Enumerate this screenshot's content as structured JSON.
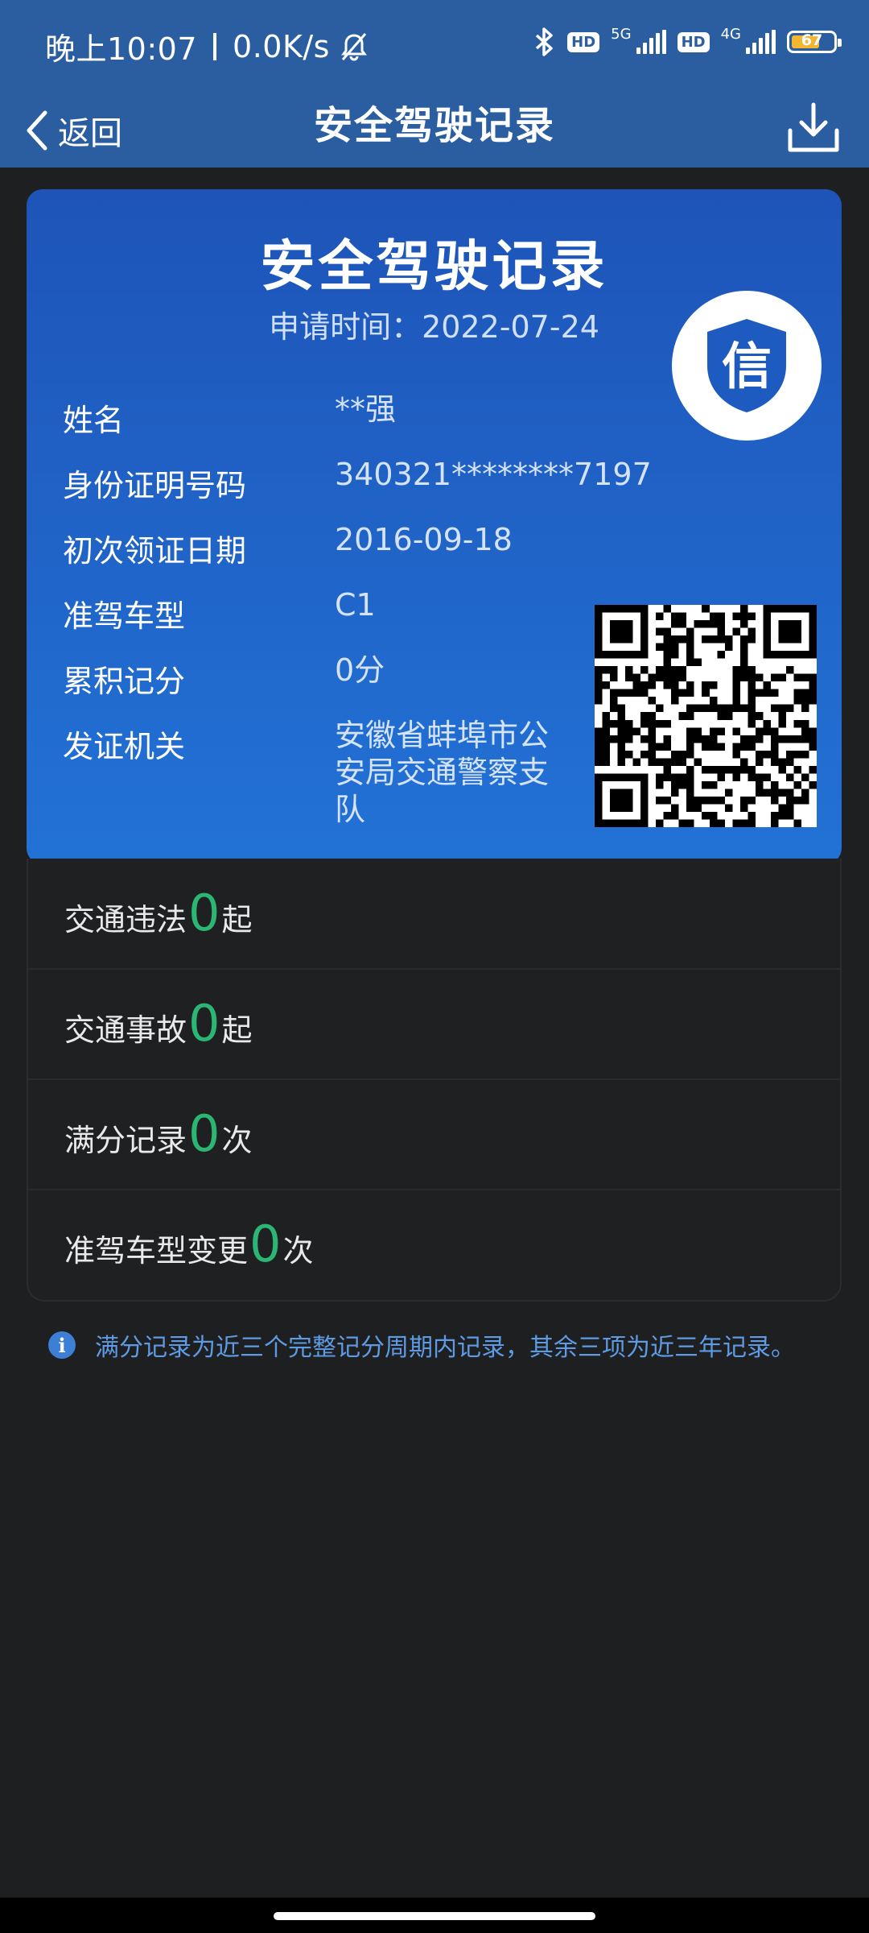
{
  "status_bar": {
    "time": "晚上10:07",
    "speed": "0.0K/s",
    "net1": "5G",
    "net2": "4G",
    "hd": "HD",
    "battery": "67"
  },
  "nav": {
    "back_label": "返回",
    "title": "安全驾驶记录"
  },
  "card": {
    "title": "安全驾驶记录",
    "apply_label": "申请时间：",
    "apply_date": "2022-07-24",
    "seal_char": "信",
    "fields": [
      {
        "label": "姓名",
        "value": "**强"
      },
      {
        "label": "身份证明号码",
        "value": "340321********7197"
      },
      {
        "label": "初次领证日期",
        "value": "2016-09-18"
      },
      {
        "label": "准驾车型",
        "value": "C1"
      },
      {
        "label": "累积记分",
        "value": "0分"
      },
      {
        "label": "发证机关",
        "value": "安徽省蚌埠市公安局交通警察支队"
      }
    ]
  },
  "records": [
    {
      "prefix": "交通违法",
      "count": "0",
      "unit": "起"
    },
    {
      "prefix": "交通事故",
      "count": "0",
      "unit": "起"
    },
    {
      "prefix": "满分记录",
      "count": "0",
      "unit": "次"
    },
    {
      "prefix": "准驾车型变更",
      "count": "0",
      "unit": "次"
    }
  ],
  "note": {
    "icon": "i",
    "text": "满分记录为近三个完整记分周期内记录，其余三项为近三年记录。"
  },
  "colors": {
    "nav_bg": "#2a5ea0",
    "card_top": "#1e54b8",
    "card_bottom": "#2272d6",
    "count_green": "#2bb673",
    "note_blue": "#5f9be4",
    "page_bg": "#1e1f21"
  }
}
